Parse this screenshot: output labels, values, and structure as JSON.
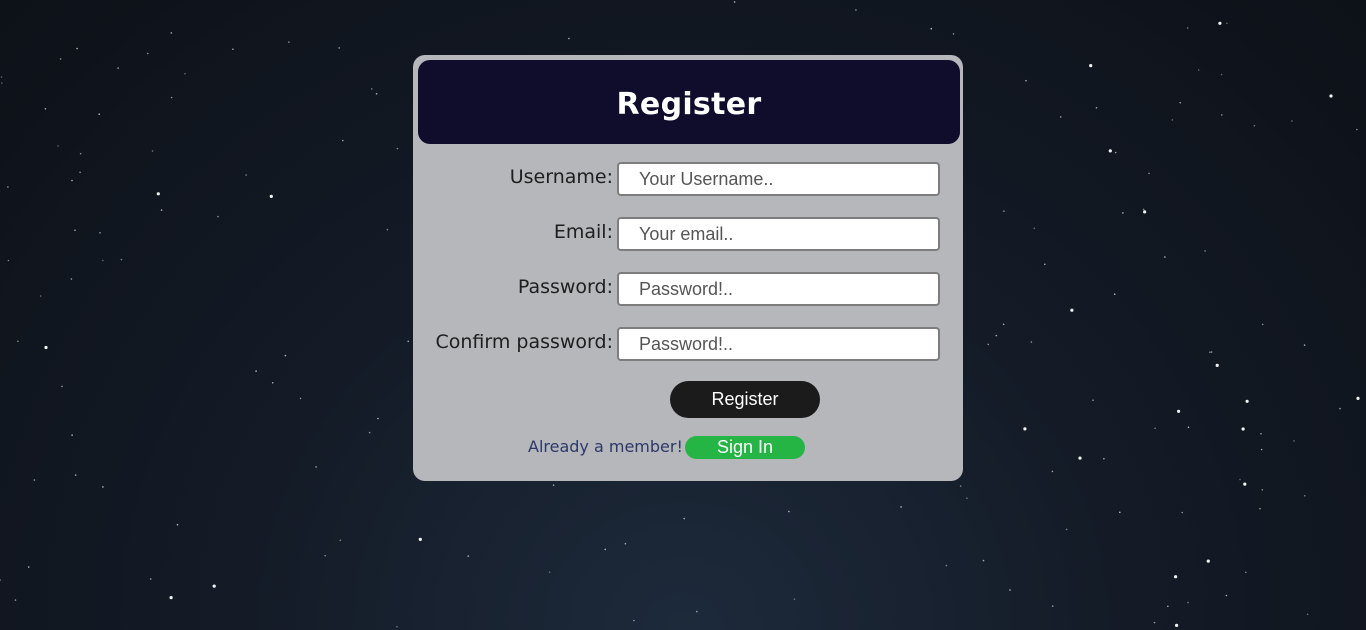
{
  "form": {
    "title": "Register",
    "fields": [
      {
        "label": "Username:",
        "placeholder": "Your Username.."
      },
      {
        "label": "Email:",
        "placeholder": "Your email.."
      },
      {
        "label": "Password:",
        "placeholder": "Password!.."
      },
      {
        "label": "Confirm password:",
        "placeholder": "Password!.."
      }
    ],
    "submit_label": "Register",
    "member_text": "Already a member!",
    "signin_label": "Sign In"
  },
  "colors": {
    "header_bg": "#0f0c2c",
    "card_bg": "#b5b7bb",
    "register_button": "#1c1b1b",
    "signin_button": "#25b544",
    "link_text": "#2c3868"
  }
}
